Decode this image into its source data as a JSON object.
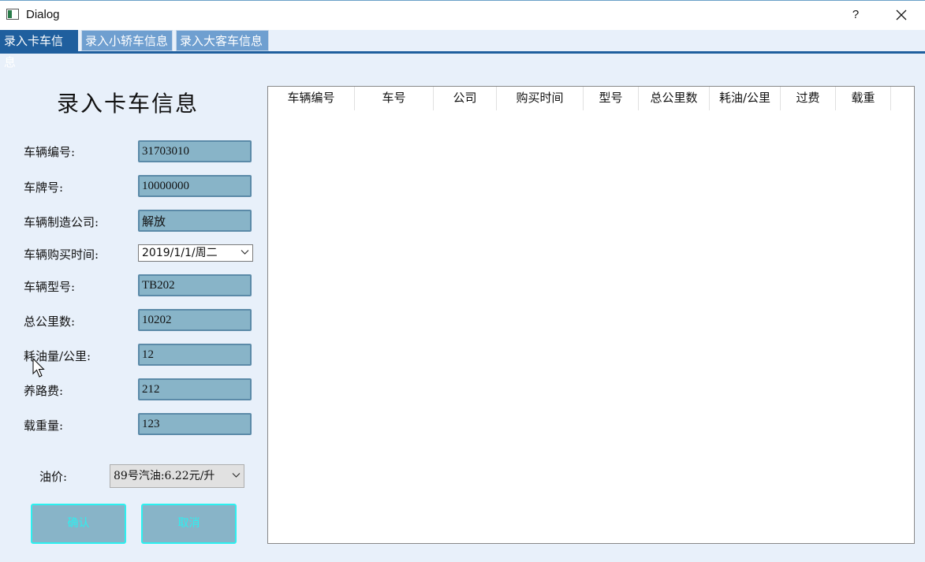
{
  "window": {
    "title": "Dialog",
    "help_label": "?"
  },
  "tabs": [
    {
      "label": "录入卡车信息",
      "active": true
    },
    {
      "label": "录入小轿车信息",
      "active": false
    },
    {
      "label": "录入大客车信息",
      "active": false
    }
  ],
  "form": {
    "title": "录入卡车信息",
    "fields": [
      {
        "label": "车辆编号:",
        "value": "31703010"
      },
      {
        "label": "车牌号:",
        "value": "10000000"
      },
      {
        "label": "车辆制造公司:",
        "value": "解放"
      },
      {
        "label": "车辆购买时间:",
        "value": "2019/1/1/周二"
      },
      {
        "label": "车辆型号:",
        "value": "TB202"
      },
      {
        "label": "总公里数:",
        "value": "10202"
      },
      {
        "label": "耗油量/公里:",
        "value": "12"
      },
      {
        "label": "养路费:",
        "value": "212"
      },
      {
        "label": "载重量:",
        "value": "123"
      }
    ],
    "oil_label": "油价:",
    "oil_value": "89号汽油:6.22元/升",
    "confirm_label": "确认",
    "cancel_label": "取消"
  },
  "table": {
    "columns": [
      "车辆编号",
      "车号",
      "公司",
      "购买时间",
      "型号",
      "总公里数",
      "耗油/公里",
      "过费",
      "载重"
    ],
    "rows": []
  },
  "colors": {
    "accent": "#1f5f9e",
    "input_bg": "#88b4c8",
    "button_border": "#2cf0f0"
  }
}
